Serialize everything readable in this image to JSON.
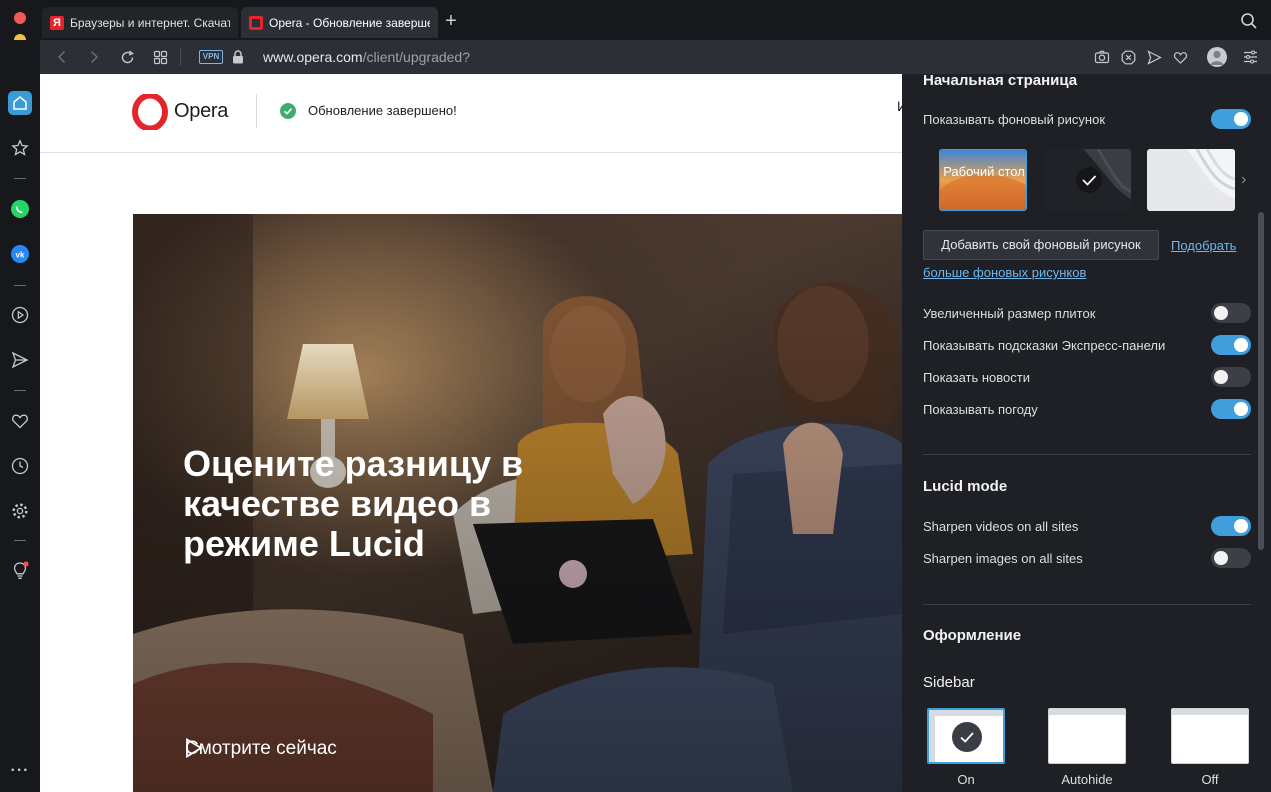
{
  "tabs": [
    {
      "title": "Браузеры и интернет. Скачать",
      "favicon": "yandex-favicon"
    },
    {
      "title": "Opera - Обновление завершено",
      "favicon": "opera-favicon"
    }
  ],
  "address": {
    "vpn_label": "VPN",
    "url_host": "www.opera.com",
    "url_path": "/client/upgraded?"
  },
  "page": {
    "logo_text": "Opera",
    "update_status": "Обновление завершено!",
    "header_cut_text": "И",
    "hero_title_line1": "Оцените разницу в",
    "hero_title_line2": "качестве видео в",
    "hero_title_line3_prefix": "режиме ",
    "hero_title_line3_bold": "Lucid",
    "watch_label": "Смотрите сейчас"
  },
  "panel": {
    "start_page_title": "Начальная страница",
    "show_bg_label": "Показывать фоновый рисунок",
    "show_bg_on": true,
    "wallpapers": [
      {
        "label": "Рабочий стол",
        "selected": false
      },
      {
        "label": "",
        "selected": true
      },
      {
        "label": "",
        "selected": false
      }
    ],
    "add_bg_button": "Добавить свой фоновый рисунок",
    "more_link_part1": "Подобрать",
    "more_link_part2": "больше фоновых рисунков",
    "options": [
      {
        "label": "Увеличенный размер плиток",
        "on": false
      },
      {
        "label": "Показывать подсказки Экспресс-панели",
        "on": true
      },
      {
        "label": "Показать новости",
        "on": false
      },
      {
        "label": "Показывать погоду",
        "on": true
      }
    ],
    "lucid_title": "Lucid mode",
    "lucid_options": [
      {
        "label": "Sharpen videos on all sites",
        "on": true
      },
      {
        "label": "Sharpen images on all sites",
        "on": false
      }
    ],
    "appearance_title": "Оформление",
    "sidebar_title": "Sidebar",
    "sidebar_modes": [
      {
        "label": "On",
        "selected": true
      },
      {
        "label": "Autohide",
        "selected": false
      },
      {
        "label": "Off",
        "selected": false
      }
    ]
  },
  "colors": {
    "accent": "#3f9fdc",
    "opera_red": "#e3242b",
    "panel_bg": "#1e2025",
    "success_green": "#3fae6a"
  }
}
